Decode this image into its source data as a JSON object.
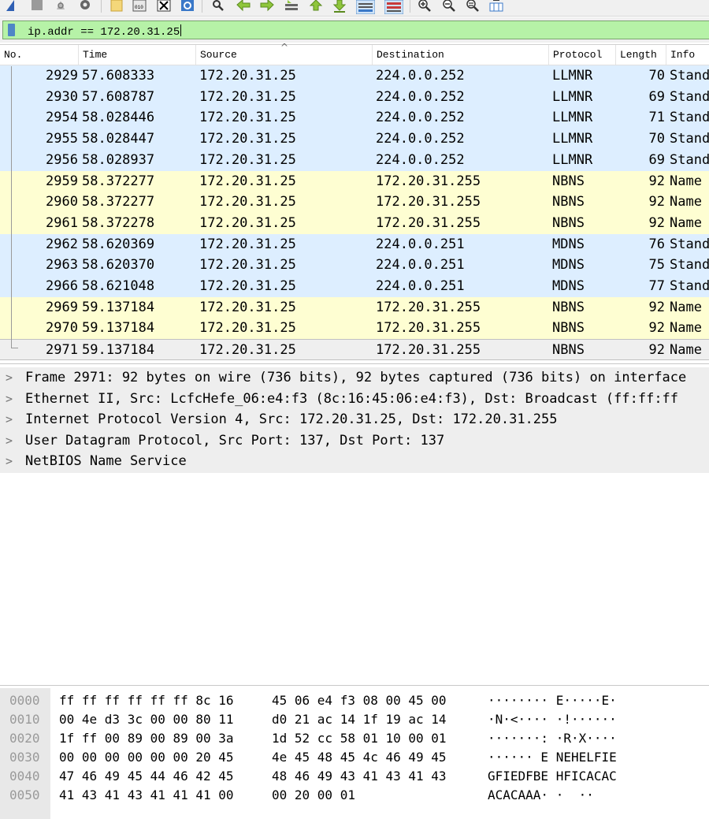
{
  "filter": {
    "expression": "ip.addr == 172.20.31.25"
  },
  "colors": {
    "llmnr_mdns_row": "#ddeeff",
    "nbns_row": "#fefed2",
    "selected_row": "#efefef",
    "filter_bg": "#b6f2a7"
  },
  "toolbar": {
    "icons": [
      "shark-fin-icon",
      "stop-icon",
      "restart-icon",
      "options-gear-icon",
      "open-file-icon",
      "save-file-icon",
      "close-file-icon",
      "reload-icon",
      "find-icon",
      "go-back-icon",
      "go-forward-icon",
      "go-to-packet-icon",
      "first-packet-icon",
      "last-packet-icon",
      "autoscroll-icon",
      "colorize-icon",
      "zoom-in-icon",
      "zoom-out-icon",
      "normal-size-icon",
      "resize-columns-icon"
    ]
  },
  "packet_list": {
    "columns": [
      "No.",
      "Time",
      "Source",
      "Destination",
      "Protocol",
      "Length",
      "Info"
    ],
    "rows": [
      {
        "no": "2929",
        "time": "57.608333",
        "src": "172.20.31.25",
        "dst": "224.0.0.252",
        "proto": "LLMNR",
        "len": "70",
        "info": "Stand",
        "kind": "blue"
      },
      {
        "no": "2930",
        "time": "57.608787",
        "src": "172.20.31.25",
        "dst": "224.0.0.252",
        "proto": "LLMNR",
        "len": "69",
        "info": "Stand",
        "kind": "blue"
      },
      {
        "no": "2954",
        "time": "58.028446",
        "src": "172.20.31.25",
        "dst": "224.0.0.252",
        "proto": "LLMNR",
        "len": "71",
        "info": "Stand",
        "kind": "blue"
      },
      {
        "no": "2955",
        "time": "58.028447",
        "src": "172.20.31.25",
        "dst": "224.0.0.252",
        "proto": "LLMNR",
        "len": "70",
        "info": "Stand",
        "kind": "blue"
      },
      {
        "no": "2956",
        "time": "58.028937",
        "src": "172.20.31.25",
        "dst": "224.0.0.252",
        "proto": "LLMNR",
        "len": "69",
        "info": "Stand",
        "kind": "blue"
      },
      {
        "no": "2959",
        "time": "58.372277",
        "src": "172.20.31.25",
        "dst": "172.20.31.255",
        "proto": "NBNS",
        "len": "92",
        "info": "Name",
        "kind": "yellow"
      },
      {
        "no": "2960",
        "time": "58.372277",
        "src": "172.20.31.25",
        "dst": "172.20.31.255",
        "proto": "NBNS",
        "len": "92",
        "info": "Name",
        "kind": "yellow"
      },
      {
        "no": "2961",
        "time": "58.372278",
        "src": "172.20.31.25",
        "dst": "172.20.31.255",
        "proto": "NBNS",
        "len": "92",
        "info": "Name",
        "kind": "yellow"
      },
      {
        "no": "2962",
        "time": "58.620369",
        "src": "172.20.31.25",
        "dst": "224.0.0.251",
        "proto": "MDNS",
        "len": "76",
        "info": "Stand",
        "kind": "blue"
      },
      {
        "no": "2963",
        "time": "58.620370",
        "src": "172.20.31.25",
        "dst": "224.0.0.251",
        "proto": "MDNS",
        "len": "75",
        "info": "Stand",
        "kind": "blue"
      },
      {
        "no": "2966",
        "time": "58.621048",
        "src": "172.20.31.25",
        "dst": "224.0.0.251",
        "proto": "MDNS",
        "len": "77",
        "info": "Stand",
        "kind": "blue"
      },
      {
        "no": "2969",
        "time": "59.137184",
        "src": "172.20.31.25",
        "dst": "172.20.31.255",
        "proto": "NBNS",
        "len": "92",
        "info": "Name",
        "kind": "yellow"
      },
      {
        "no": "2970",
        "time": "59.137184",
        "src": "172.20.31.25",
        "dst": "172.20.31.255",
        "proto": "NBNS",
        "len": "92",
        "info": "Name",
        "kind": "yellow"
      },
      {
        "no": "2971",
        "time": "59.137184",
        "src": "172.20.31.25",
        "dst": "172.20.31.255",
        "proto": "NBNS",
        "len": "92",
        "info": "Name",
        "kind": "selected"
      }
    ]
  },
  "details": [
    "Frame 2971: 92 bytes on wire (736 bits), 92 bytes captured (736 bits) on interface",
    "Ethernet II, Src: LcfcHefe_06:e4:f3 (8c:16:45:06:e4:f3), Dst: Broadcast (ff:ff:ff",
    "Internet Protocol Version 4, Src: 172.20.31.25, Dst: 172.20.31.255",
    "User Datagram Protocol, Src Port: 137, Dst Port: 137",
    "NetBIOS Name Service"
  ],
  "bytes": [
    {
      "off": "0000",
      "h1": "ff ff ff ff ff ff 8c 16",
      "h2": "45 06 e4 f3 08 00 45 00",
      "ascii": "········ E·····E·"
    },
    {
      "off": "0010",
      "h1": "00 4e d3 3c 00 00 80 11",
      "h2": "d0 21 ac 14 1f 19 ac 14",
      "ascii": "·N·<···· ·!······"
    },
    {
      "off": "0020",
      "h1": "1f ff 00 89 00 89 00 3a",
      "h2": "1d 52 cc 58 01 10 00 01",
      "ascii": "·······: ·R·X····"
    },
    {
      "off": "0030",
      "h1": "00 00 00 00 00 00 20 45",
      "h2": "4e 45 48 45 4c 46 49 45",
      "ascii": "······ E NEHELFIE"
    },
    {
      "off": "0040",
      "h1": "47 46 49 45 44 46 42 45",
      "h2": "48 46 49 43 41 43 41 43",
      "ascii": "GFIEDFBE HFICACAC"
    },
    {
      "off": "0050",
      "h1": "41 43 41 43 41 41 41 00",
      "h2": "00 20 00 01",
      "ascii": "ACACAAA· ·  ··"
    }
  ]
}
